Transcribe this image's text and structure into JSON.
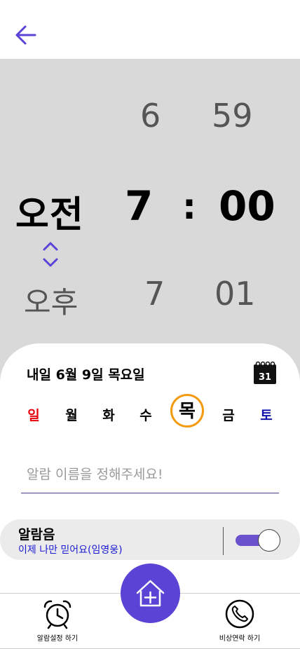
{
  "header": {
    "back_icon": "arrow-left-icon"
  },
  "picker": {
    "ampm_selected": "오전",
    "ampm_next": "오후",
    "hour_prev": "6",
    "hour_selected": "7",
    "hour_next": "7",
    "separator": ":",
    "minute_prev": "59",
    "minute_selected": "00",
    "minute_next": "01",
    "toggle_icon": "chevron-up-down-icon"
  },
  "date": {
    "text": "내일 6월 9일 목요일",
    "calendar_number": "31",
    "calendar_icon": "calendar-icon"
  },
  "weekdays": [
    {
      "label": "일",
      "selected": false
    },
    {
      "label": "월",
      "selected": false
    },
    {
      "label": "화",
      "selected": false
    },
    {
      "label": "수",
      "selected": false
    },
    {
      "label": "목",
      "selected": true
    },
    {
      "label": "금",
      "selected": false
    },
    {
      "label": "토",
      "selected": false
    }
  ],
  "name_input": {
    "placeholder": "알람 이름을 정해주세요!",
    "value": ""
  },
  "sound": {
    "title": "알람음",
    "subtitle": "이제 나만 믿어요(임영웅)",
    "enabled": true
  },
  "bottom_nav": {
    "alarm_label": "알람설정 하기",
    "emergency_label": "비상연락 하기",
    "home_icon": "home-add-icon"
  },
  "colors": {
    "accent": "#5b43d6",
    "picker_bg": "#d9d9d9",
    "sunday": "#e8000b",
    "saturday": "#1010a8",
    "selected_ring": "#f39a11",
    "sound_subtitle": "#1a1ad6"
  }
}
